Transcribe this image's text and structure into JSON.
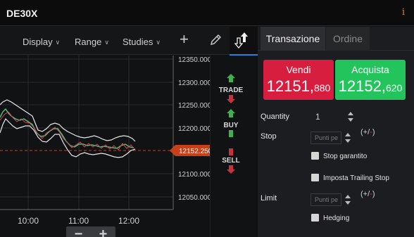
{
  "window": {
    "title": "DE30X",
    "info_icon": "i"
  },
  "chart_toolbar": {
    "display_label": "Display",
    "range_label": "Range",
    "studies_label": "Studies",
    "chevron": "∨",
    "add_symbol": "+"
  },
  "chart": {
    "y_ticks": [
      "12350.000",
      "12300.000",
      "12250.000",
      "12200.000",
      "12100.000",
      "12050.000"
    ],
    "x_ticks": [
      "10:00",
      "11:00",
      "12:00"
    ],
    "current_price": "12152.250",
    "zoom_minus": "−",
    "zoom_plus": "+"
  },
  "side_actions": {
    "trade_label": "TRADE",
    "buy_label": "BUY",
    "sell_label": "SELL"
  },
  "trade_panel": {
    "tabs": [
      {
        "label": "Transazione",
        "active": true
      },
      {
        "label": "Ordine",
        "active": false
      }
    ],
    "sell": {
      "label": "Vendi",
      "price_big": "12151,",
      "price_small": "880"
    },
    "buy": {
      "label": "Acquista",
      "price_big": "12152,",
      "price_small": "620"
    },
    "quantity_label": "Quantity",
    "quantity_value": "1",
    "stop_label": "Stop",
    "stop_placeholder": "Punti pe",
    "stop_sign_open": "(",
    "stop_sign_plus": "+",
    "stop_sign_slash": "/",
    "stop_sign_minus": "-",
    "stop_sign_close": ")",
    "guaranteed_stop_label": "Stop garantito",
    "trailing_stop_label": "Imposta Trailing Stop",
    "limit_label": "Limit",
    "limit_placeholder": "Punti pe",
    "hedging_label": "Hedging"
  },
  "colors": {
    "sell": "#d71e3f",
    "buy": "#23c45b",
    "price_tag": "#c8401a",
    "accent": "#2a7de1"
  }
}
